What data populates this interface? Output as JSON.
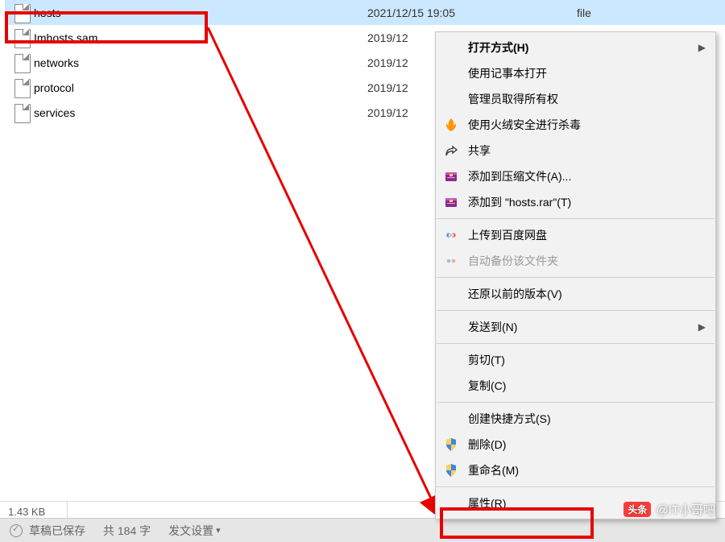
{
  "files": [
    {
      "name": "hosts",
      "date": "2021/12/15 19:05",
      "type": "file",
      "selected": true
    },
    {
      "name": "Imhosts.sam",
      "date": "2019/12",
      "type": "",
      "selected": false
    },
    {
      "name": "networks",
      "date": "2019/12",
      "type": "",
      "selected": false
    },
    {
      "name": "protocol",
      "date": "2019/12",
      "type": "",
      "selected": false
    },
    {
      "name": "services",
      "date": "2019/12",
      "type": "",
      "selected": false
    }
  ],
  "contextMenu": {
    "openWith": "打开方式(H)",
    "openWithNotepad": "使用记事本打开",
    "adminTakeOwnership": "管理员取得所有权",
    "huorongScan": "使用火绒安全进行杀毒",
    "share": "共享",
    "addToArchive": "添加到压缩文件(A)...",
    "addToHostsRar": "添加到 \"hosts.rar\"(T)",
    "uploadBaiduPan": "上传到百度网盘",
    "autoBackupFolder": "自动备份该文件夹",
    "restorePrevious": "还原以前的版本(V)",
    "sendTo": "发送到(N)",
    "cut": "剪切(T)",
    "copy": "复制(C)",
    "createShortcut": "创建快捷方式(S)",
    "delete": "删除(D)",
    "rename": "重命名(M)",
    "properties": "属性(R)"
  },
  "status": {
    "size": "1.43 KB"
  },
  "bottom": {
    "draftSaved": "草稿已保存",
    "wordCountPrefix": "共",
    "wordCountValue": "184",
    "wordCountSuffix": "字",
    "publishSettings": "发文设置"
  },
  "watermark": {
    "badge": "头条",
    "text": "@IT小哥吧"
  }
}
